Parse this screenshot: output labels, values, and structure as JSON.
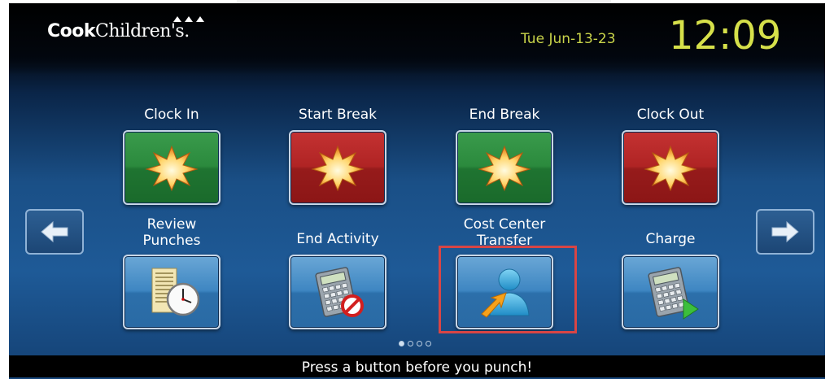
{
  "header": {
    "logo_bold": "Cook",
    "logo_regular": "Children's.",
    "date": "Tue Jun-13-23",
    "time": "12:09"
  },
  "tiles": [
    {
      "label": "Clock In",
      "icon": "starburst-icon",
      "color": "#2b8a3d"
    },
    {
      "label": "Start Break",
      "icon": "starburst-icon",
      "color": "#b02424"
    },
    {
      "label": "End Break",
      "icon": "starburst-icon",
      "color": "#2b8a3d"
    },
    {
      "label": "Clock Out",
      "icon": "starburst-icon",
      "color": "#b02424"
    },
    {
      "label": "Review Punches",
      "icon": "timesheet-clock-icon",
      "color": "#3e86c2"
    },
    {
      "label": "End Activity",
      "icon": "calculator-no-icon",
      "color": "#3e86c2"
    },
    {
      "label": "Cost Center Transfer",
      "icon": "person-arrow-icon",
      "color": "#3e86c2",
      "highlighted": true
    },
    {
      "label": "Charge",
      "icon": "calculator-play-icon",
      "color": "#3e86c2"
    }
  ],
  "navigation": {
    "prev_icon": "arrow-left-icon",
    "next_icon": "arrow-right-icon",
    "page_indicator": {
      "current": 1,
      "total": 4
    }
  },
  "footer": {
    "message": "Press a button before you punch!"
  },
  "colors": {
    "clock_text": "#d6e04a",
    "highlight_border": "#d84545"
  }
}
